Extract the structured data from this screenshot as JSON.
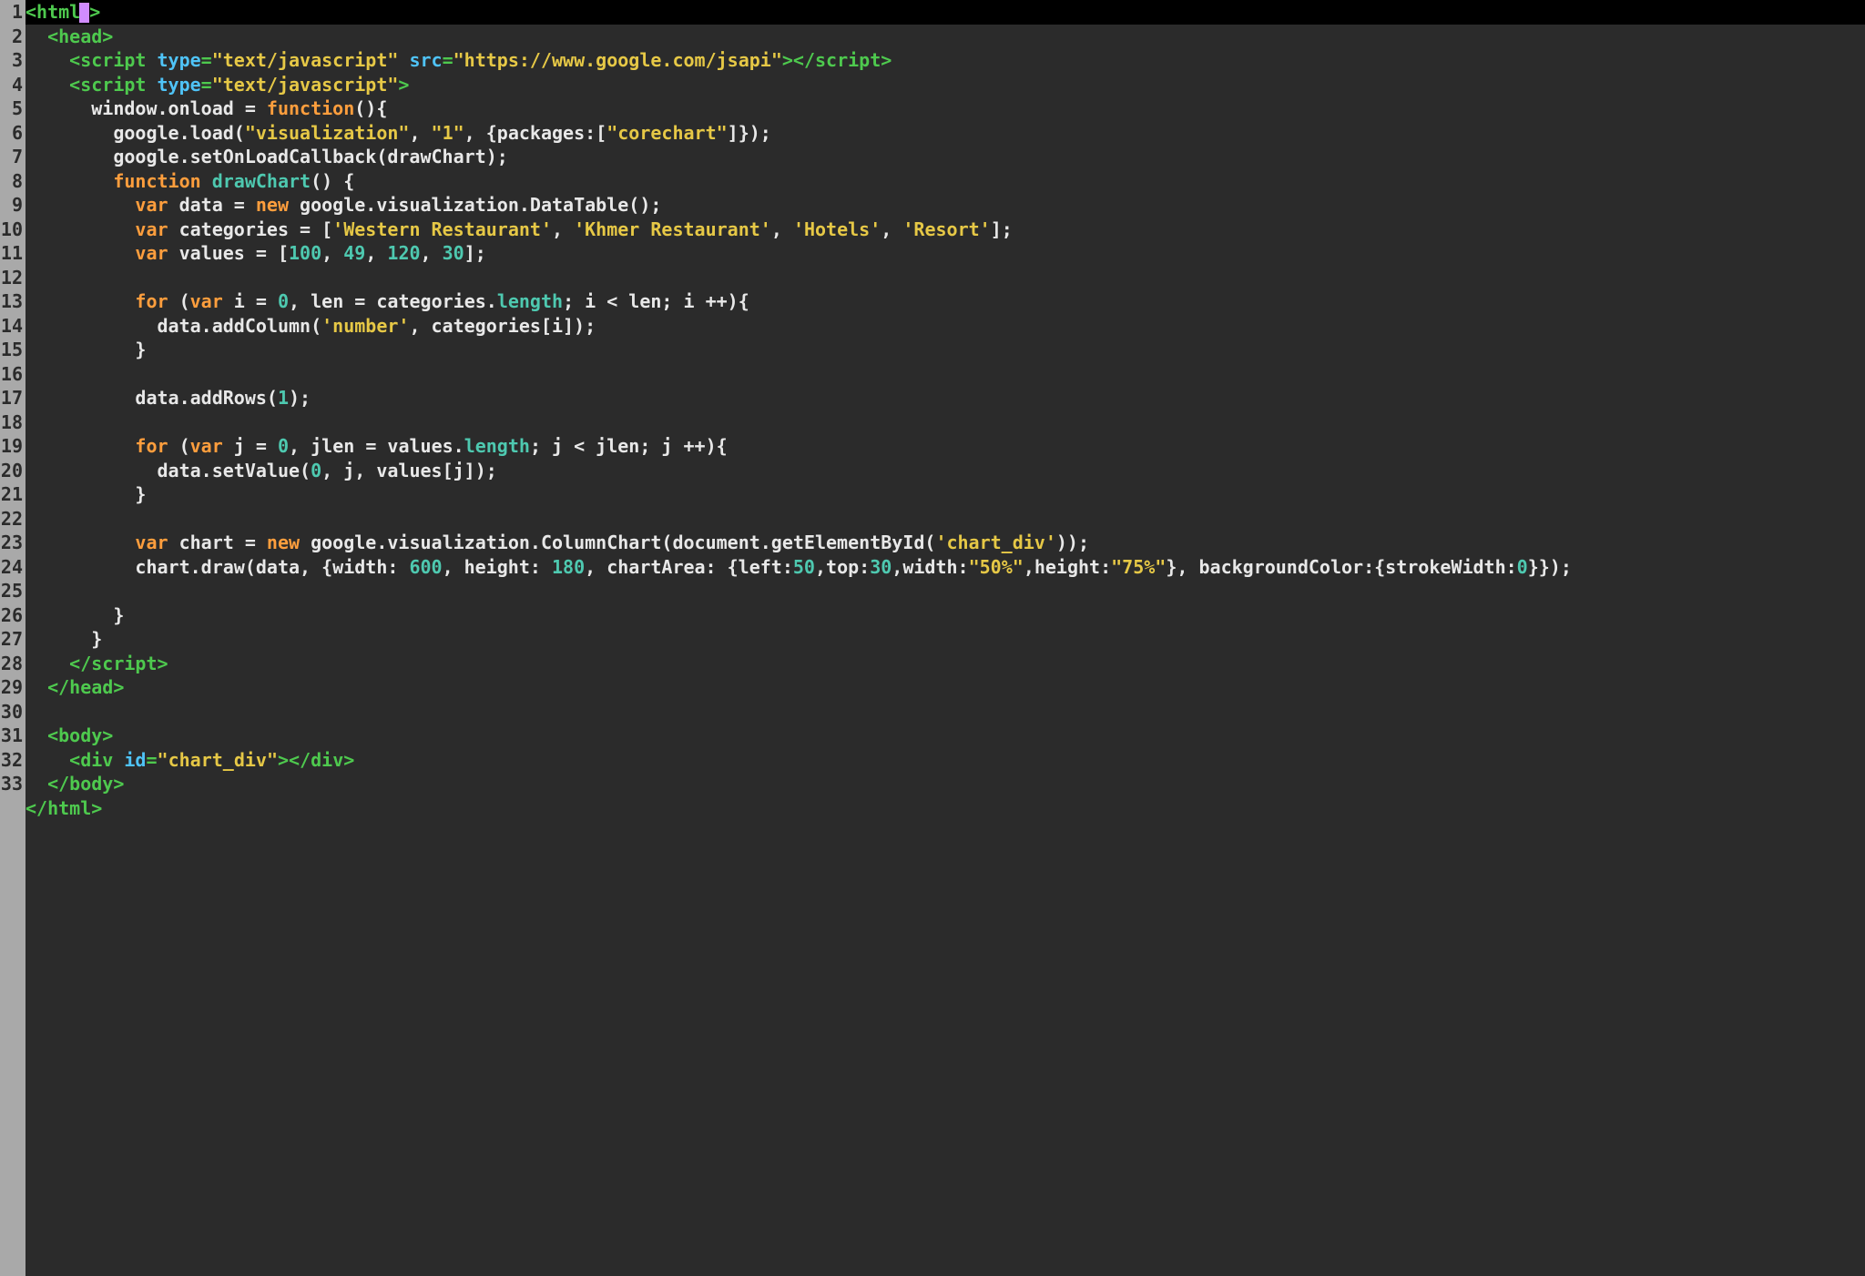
{
  "gutter": {
    "total_lines": 33
  },
  "code_tokens": [
    [
      {
        "c": "tag",
        "t": "<html"
      },
      {
        "c": "caret",
        "t": ""
      },
      {
        "c": "tag",
        "t": ">"
      }
    ],
    [
      {
        "c": "id",
        "t": "  "
      },
      {
        "c": "tag",
        "t": "<head>"
      }
    ],
    [
      {
        "c": "id",
        "t": "    "
      },
      {
        "c": "tag",
        "t": "<script "
      },
      {
        "c": "attr",
        "t": "type"
      },
      {
        "c": "tag",
        "t": "="
      },
      {
        "c": "str",
        "t": "\"text/javascript\""
      },
      {
        "c": "tag",
        "t": " "
      },
      {
        "c": "attr",
        "t": "src"
      },
      {
        "c": "tag",
        "t": "="
      },
      {
        "c": "str",
        "t": "\"https://www.google.com/jsapi\""
      },
      {
        "c": "tag",
        "t": "></"
      },
      {
        "c": "tag",
        "t": "script>"
      }
    ],
    [
      {
        "c": "id",
        "t": "    "
      },
      {
        "c": "tag",
        "t": "<script "
      },
      {
        "c": "attr",
        "t": "type"
      },
      {
        "c": "tag",
        "t": "="
      },
      {
        "c": "str",
        "t": "\"text/javascript\""
      },
      {
        "c": "tag",
        "t": ">"
      }
    ],
    [
      {
        "c": "id",
        "t": "      window.onload = "
      },
      {
        "c": "kw",
        "t": "function"
      },
      {
        "c": "id",
        "t": "(){"
      }
    ],
    [
      {
        "c": "id",
        "t": "        google.load("
      },
      {
        "c": "str",
        "t": "\"visualization\""
      },
      {
        "c": "id",
        "t": ", "
      },
      {
        "c": "str",
        "t": "\"1\""
      },
      {
        "c": "id",
        "t": ", {packages:["
      },
      {
        "c": "str",
        "t": "\"corechart\""
      },
      {
        "c": "id",
        "t": "]});"
      }
    ],
    [
      {
        "c": "id",
        "t": "        google.setOnLoadCallback(drawChart);"
      }
    ],
    [
      {
        "c": "id",
        "t": "        "
      },
      {
        "c": "kw",
        "t": "function"
      },
      {
        "c": "id",
        "t": " "
      },
      {
        "c": "fn",
        "t": "drawChart"
      },
      {
        "c": "id",
        "t": "() {"
      }
    ],
    [
      {
        "c": "id",
        "t": "          "
      },
      {
        "c": "kw",
        "t": "var"
      },
      {
        "c": "id",
        "t": " data = "
      },
      {
        "c": "kw",
        "t": "new"
      },
      {
        "c": "id",
        "t": " google.visualization.DataTable();"
      }
    ],
    [
      {
        "c": "id",
        "t": "          "
      },
      {
        "c": "kw",
        "t": "var"
      },
      {
        "c": "id",
        "t": " categories = ["
      },
      {
        "c": "str",
        "t": "'Western Restaurant'"
      },
      {
        "c": "id",
        "t": ", "
      },
      {
        "c": "str",
        "t": "'Khmer Restaurant'"
      },
      {
        "c": "id",
        "t": ", "
      },
      {
        "c": "str",
        "t": "'Hotels'"
      },
      {
        "c": "id",
        "t": ", "
      },
      {
        "c": "str",
        "t": "'Resort'"
      },
      {
        "c": "id",
        "t": "];"
      }
    ],
    [
      {
        "c": "id",
        "t": "          "
      },
      {
        "c": "kw",
        "t": "var"
      },
      {
        "c": "id",
        "t": " values = ["
      },
      {
        "c": "num",
        "t": "100"
      },
      {
        "c": "id",
        "t": ", "
      },
      {
        "c": "num",
        "t": "49"
      },
      {
        "c": "id",
        "t": ", "
      },
      {
        "c": "num",
        "t": "120"
      },
      {
        "c": "id",
        "t": ", "
      },
      {
        "c": "num",
        "t": "30"
      },
      {
        "c": "id",
        "t": "];"
      }
    ],
    [
      {
        "c": "id",
        "t": ""
      }
    ],
    [
      {
        "c": "id",
        "t": "          "
      },
      {
        "c": "kw",
        "t": "for"
      },
      {
        "c": "id",
        "t": " ("
      },
      {
        "c": "kw",
        "t": "var"
      },
      {
        "c": "id",
        "t": " i = "
      },
      {
        "c": "num",
        "t": "0"
      },
      {
        "c": "id",
        "t": ", len = categories."
      },
      {
        "c": "prop",
        "t": "length"
      },
      {
        "c": "id",
        "t": "; i < len; i ++){"
      }
    ],
    [
      {
        "c": "id",
        "t": "            data.addColumn("
      },
      {
        "c": "str",
        "t": "'number'"
      },
      {
        "c": "id",
        "t": ", categories[i]);"
      }
    ],
    [
      {
        "c": "id",
        "t": "          }"
      }
    ],
    [
      {
        "c": "id",
        "t": ""
      }
    ],
    [
      {
        "c": "id",
        "t": "          data.addRows("
      },
      {
        "c": "num",
        "t": "1"
      },
      {
        "c": "id",
        "t": ");"
      }
    ],
    [
      {
        "c": "id",
        "t": ""
      }
    ],
    [
      {
        "c": "id",
        "t": "          "
      },
      {
        "c": "kw",
        "t": "for"
      },
      {
        "c": "id",
        "t": " ("
      },
      {
        "c": "kw",
        "t": "var"
      },
      {
        "c": "id",
        "t": " j = "
      },
      {
        "c": "num",
        "t": "0"
      },
      {
        "c": "id",
        "t": ", jlen = values."
      },
      {
        "c": "prop",
        "t": "length"
      },
      {
        "c": "id",
        "t": "; j < jlen; j ++){"
      }
    ],
    [
      {
        "c": "id",
        "t": "            data.setValue("
      },
      {
        "c": "num",
        "t": "0"
      },
      {
        "c": "id",
        "t": ", j, values[j]);"
      }
    ],
    [
      {
        "c": "id",
        "t": "          }"
      }
    ],
    [
      {
        "c": "id",
        "t": ""
      }
    ],
    [
      {
        "c": "id",
        "t": "          "
      },
      {
        "c": "kw",
        "t": "var"
      },
      {
        "c": "id",
        "t": " chart = "
      },
      {
        "c": "kw",
        "t": "new"
      },
      {
        "c": "id",
        "t": " google.visualization.ColumnChart(document.getElementById("
      },
      {
        "c": "str",
        "t": "'chart_div'"
      },
      {
        "c": "id",
        "t": "));"
      }
    ],
    [
      {
        "c": "id",
        "t": "          chart.draw(data, {width: "
      },
      {
        "c": "num",
        "t": "600"
      },
      {
        "c": "id",
        "t": ", height: "
      },
      {
        "c": "num",
        "t": "180"
      },
      {
        "c": "id",
        "t": ", chartArea: {left:"
      },
      {
        "c": "num",
        "t": "50"
      },
      {
        "c": "id",
        "t": ",top:"
      },
      {
        "c": "num",
        "t": "30"
      },
      {
        "c": "id",
        "t": ",width:"
      },
      {
        "c": "str",
        "t": "\"50%\""
      },
      {
        "c": "id",
        "t": ",height:"
      },
      {
        "c": "str",
        "t": "\"75%\""
      },
      {
        "c": "id",
        "t": "}, backgroundColor:{strokeWidth:"
      },
      {
        "c": "num",
        "t": "0"
      },
      {
        "c": "id",
        "t": "}});"
      }
    ],
    [
      {
        "c": "id",
        "t": "        }"
      }
    ],
    [
      {
        "c": "id",
        "t": "      }"
      }
    ],
    [
      {
        "c": "id",
        "t": "    "
      },
      {
        "c": "tag",
        "t": "</"
      },
      {
        "c": "tag",
        "t": "script>"
      }
    ],
    [
      {
        "c": "id",
        "t": "  "
      },
      {
        "c": "tag",
        "t": "</head>"
      }
    ],
    [
      {
        "c": "id",
        "t": ""
      }
    ],
    [
      {
        "c": "id",
        "t": "  "
      },
      {
        "c": "tag",
        "t": "<body>"
      }
    ],
    [
      {
        "c": "id",
        "t": "    "
      },
      {
        "c": "tag",
        "t": "<div "
      },
      {
        "c": "attr",
        "t": "id"
      },
      {
        "c": "tag",
        "t": "="
      },
      {
        "c": "str",
        "t": "\"chart_div\""
      },
      {
        "c": "tag",
        "t": "></div>"
      }
    ],
    [
      {
        "c": "id",
        "t": "  "
      },
      {
        "c": "tag",
        "t": "</body>"
      }
    ],
    [
      {
        "c": "tag",
        "t": "</html>"
      }
    ]
  ],
  "wrapped_line_index": 23,
  "wrap_split_after_token": 15
}
